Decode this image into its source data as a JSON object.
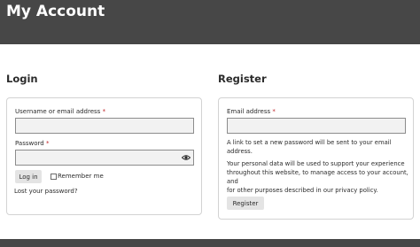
{
  "header": {
    "title": "My Account"
  },
  "login": {
    "heading": "Login",
    "username_label": "Username or email address",
    "username_value": "",
    "password_label": "Password",
    "password_value": "",
    "required_mark": "*",
    "login_button": "Log in",
    "remember_label": "Remember me",
    "lost_password_link": "Lost your password?"
  },
  "register": {
    "heading": "Register",
    "email_label": "Email address",
    "email_value": "",
    "required_mark": "*",
    "password_note": "A link to set a new password will be sent to your email address.",
    "privacy_line1": "Your personal data will be used to support your experience",
    "privacy_line2": "throughout this website, to manage access to your account, and",
    "privacy_line3": "for other purposes described in our privacy policy.",
    "register_button": "Register"
  },
  "icons": {
    "password_toggle": "eye-icon",
    "checkbox": "checkbox"
  },
  "colors": {
    "header_bg": "#474747",
    "required": "#c0262a",
    "input_bg": "#f2f2f2",
    "button_bg": "#e4e4e4",
    "box_border": "#d3d3d3"
  }
}
